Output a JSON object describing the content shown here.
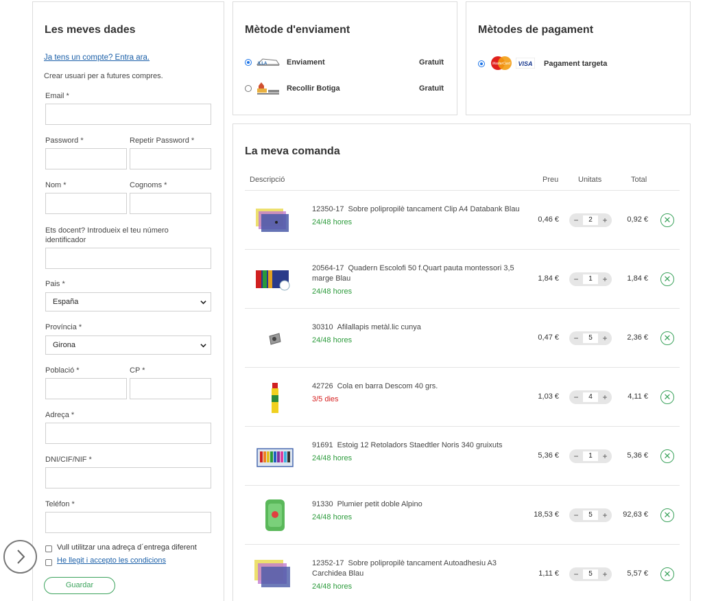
{
  "dades": {
    "title": "Les meves dades",
    "login_link": "Ja tens un compte? Entra ara.",
    "create_note": "Crear usuari per a futures compres.",
    "email_label": "Email *",
    "password_label": "Password *",
    "repeat_password_label": "Repetir Password *",
    "nom_label": "Nom *",
    "cognoms_label": "Cognoms *",
    "docent_label": "Ets docent? Introdueix el teu número identificador",
    "pais_label": "Pais *",
    "pais_value": "España",
    "provincia_label": "Província *",
    "provincia_value": "Girona",
    "poblacio_label": "Població *",
    "cp_label": "CP *",
    "adreca_label": "Adreça *",
    "dni_label": "DNI/CIF/NIF *",
    "telefon_label": "Teléfon *",
    "alt_address_label": "Vull utilitzar una adreça d´entrega diferent",
    "terms_label": "He llegit i accepto les condicions",
    "save_label": "Guardar"
  },
  "enviament": {
    "title": "Mètode d'enviament",
    "options": [
      {
        "name": "Enviament",
        "price": "Gratuït",
        "selected": true,
        "icon": "truck-icon"
      },
      {
        "name": "Recollir Botiga",
        "price": "Gratuït",
        "selected": false,
        "icon": "store-icon"
      }
    ]
  },
  "pagament": {
    "title": "Mètodes de pagament",
    "option": {
      "name": "Pagament targeta",
      "selected": true,
      "icons": [
        "mastercard-icon",
        "visa-icon"
      ]
    },
    "mastercard_text": "MasterCard",
    "visa_text": "VISA"
  },
  "comanda": {
    "title": "La meva comanda",
    "headers": {
      "descripcio": "Descripció",
      "preu": "Preu",
      "unitats": "Unitats",
      "total": "Total"
    },
    "items": [
      {
        "code": "12350-17",
        "name": "Sobre polipropilè tancament Clip A4 Databank Blau",
        "availability": "24/48 hores",
        "avail_color": "green",
        "price": "0,46 €",
        "qty": "2",
        "total": "0,92 €"
      },
      {
        "code": "20564-17",
        "name": "Quadern Escolofi 50 f.Quart pauta montessori 3,5 marge Blau",
        "availability": "24/48 hores",
        "avail_color": "green",
        "price": "1,84 €",
        "qty": "1",
        "total": "1,84 €"
      },
      {
        "code": "30310",
        "name": "Afilallapis metàl.lic cunya",
        "availability": "24/48 hores",
        "avail_color": "green",
        "price": "0,47 €",
        "qty": "5",
        "total": "2,36 €"
      },
      {
        "code": "42726",
        "name": "Cola en barra Descom 40 grs.",
        "availability": "3/5 dies",
        "avail_color": "red",
        "price": "1,03 €",
        "qty": "4",
        "total": "4,11 €"
      },
      {
        "code": "91691",
        "name": "Estoig 12 Retoladors Staedtler Noris 340 gruixuts",
        "availability": "24/48 hores",
        "avail_color": "green",
        "price": "5,36 €",
        "qty": "1",
        "total": "5,36 €"
      },
      {
        "code": "91330",
        "name": "Plumier petit doble Alpino",
        "availability": "24/48 hores",
        "avail_color": "green",
        "price": "18,53 €",
        "qty": "5",
        "total": "92,63 €"
      },
      {
        "code": "12352-17",
        "name": "Sobre polipropilè tancament Autoadhesiu A3 Carchidea Blau",
        "availability": "24/48 hores",
        "avail_color": "green",
        "price": "1,11 €",
        "qty": "5",
        "total": "5,57 €"
      }
    ]
  },
  "colors": {
    "accent_green": "#3aa25b",
    "link_blue": "#1a5fa8",
    "warning_red": "#d62020"
  }
}
